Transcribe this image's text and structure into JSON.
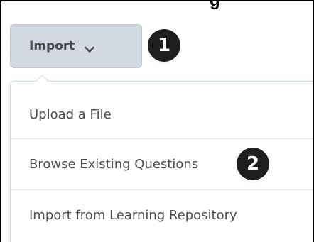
{
  "header": {
    "title_fragment": "g"
  },
  "import_button": {
    "label": "Import",
    "icon": "chevron-down-icon"
  },
  "callouts": {
    "step1": "1",
    "step2": "2"
  },
  "dropdown": {
    "items": [
      {
        "label": "Upload a File"
      },
      {
        "label": "Browse Existing Questions"
      },
      {
        "label": "Import from Learning Repository"
      }
    ]
  },
  "colors": {
    "button_bg": "#d3d9e3",
    "text": "#494c4e",
    "badge_bg": "#1e1e1e",
    "frame": "#000000"
  }
}
